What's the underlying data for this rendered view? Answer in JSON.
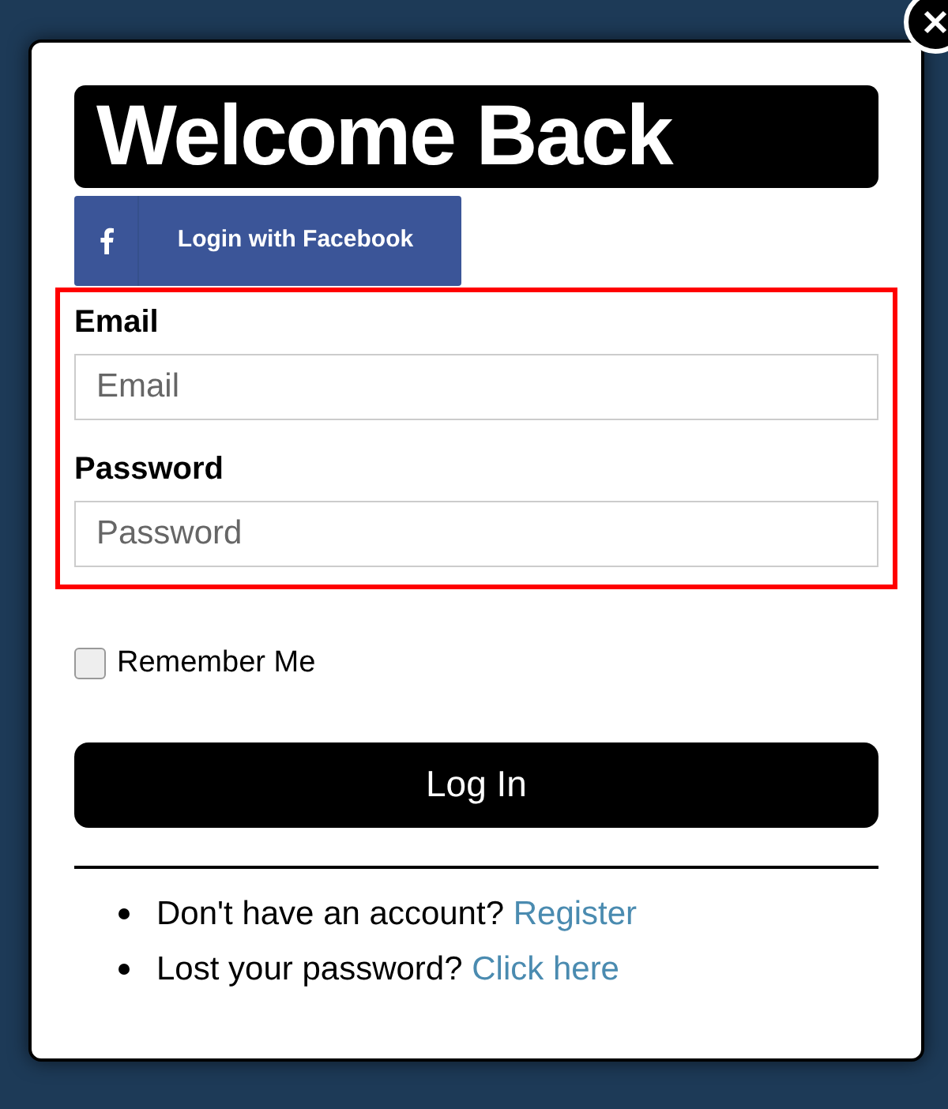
{
  "title": "Welcome Back",
  "facebook_button": {
    "label": "Login with Facebook"
  },
  "fields": [
    {
      "label": "Email",
      "placeholder": "Email"
    },
    {
      "label": "Password",
      "placeholder": "Password"
    }
  ],
  "remember": {
    "label": "Remember Me",
    "checked": false
  },
  "submit": {
    "label": "Log In"
  },
  "links": [
    {
      "text": "Don't have an account?",
      "link": "Register"
    },
    {
      "text": "Lost your password?",
      "link": "Click here"
    }
  ]
}
